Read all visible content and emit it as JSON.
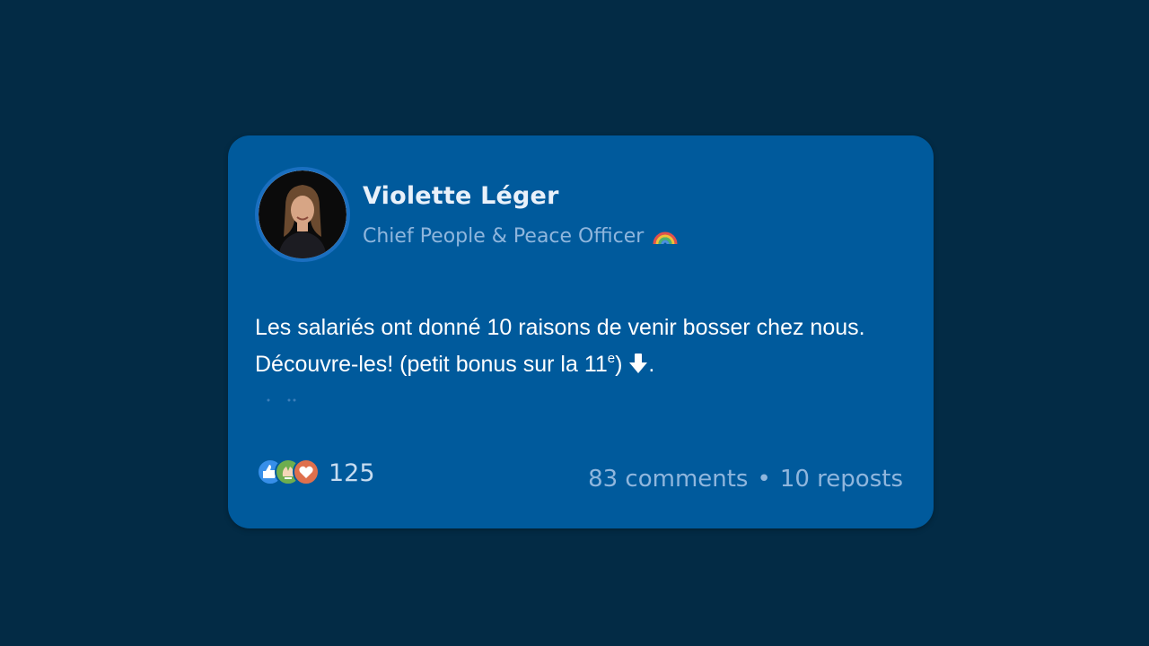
{
  "post": {
    "author": {
      "name": "Violette Léger",
      "title": "Chief People & Peace Officer",
      "title_icon": "rainbow-icon"
    },
    "body": {
      "text_main": "Les salariés ont donné 10 raisons de venir bosser chez nous. Découvre-les! (petit bonus sur la 11",
      "superscript": "e",
      "text_after": ") ",
      "arrow_icon": "down-arrow-icon",
      "text_end": "."
    },
    "reactions": {
      "icons": [
        "like-icon",
        "celebrate-icon",
        "love-icon"
      ],
      "count": "125"
    },
    "stats": {
      "comments": "83 comments",
      "separator": "•",
      "reposts": "10 reposts"
    }
  },
  "colors": {
    "page_background": "#032b45",
    "card_background": "#005a9c",
    "name_text": "#e9f1fa",
    "muted_text": "#8fb6dd",
    "body_text": "#ffffff"
  }
}
